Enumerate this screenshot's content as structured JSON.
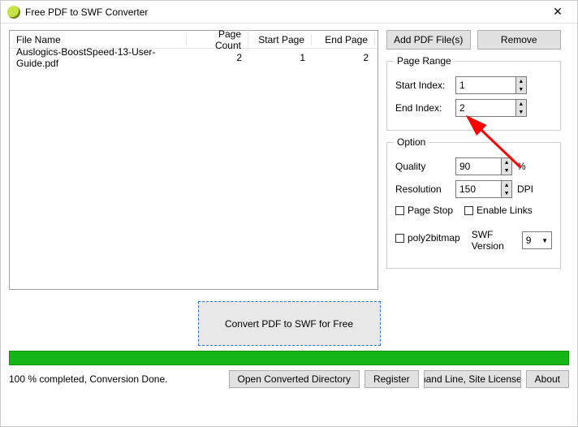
{
  "window": {
    "title": "Free PDF to SWF Converter"
  },
  "table": {
    "headers": {
      "file": "File Name",
      "count": "Page Count",
      "start": "Start Page",
      "end": "End Page"
    },
    "row": {
      "file": "Auslogics-BoostSpeed-13-User-Guide.pdf",
      "count": "2",
      "start": "1",
      "end": "2"
    }
  },
  "buttons": {
    "add": "Add PDF File(s)",
    "remove": "Remove",
    "convert": "Convert PDF to SWF for Free",
    "open_dir": "Open Converted Directory",
    "register": "Register",
    "command": "Command Line, Site License, SDK",
    "about": "About"
  },
  "page_range": {
    "legend": "Page Range",
    "start_label": "Start Index:",
    "start_value": "1",
    "end_label": "End Index:",
    "end_value": "2"
  },
  "option": {
    "legend": "Option",
    "quality_label": "Quality",
    "quality_value": "90",
    "quality_unit": "%",
    "res_label": "Resolution",
    "res_value": "150",
    "res_unit": "DPI",
    "page_stop": "Page Stop",
    "enable_links": "Enable Links",
    "poly2bitmap": "poly2bitmap",
    "swf_ver_label": "SWF Version",
    "swf_ver_value": "9"
  },
  "status": "100 % completed, Conversion Done."
}
